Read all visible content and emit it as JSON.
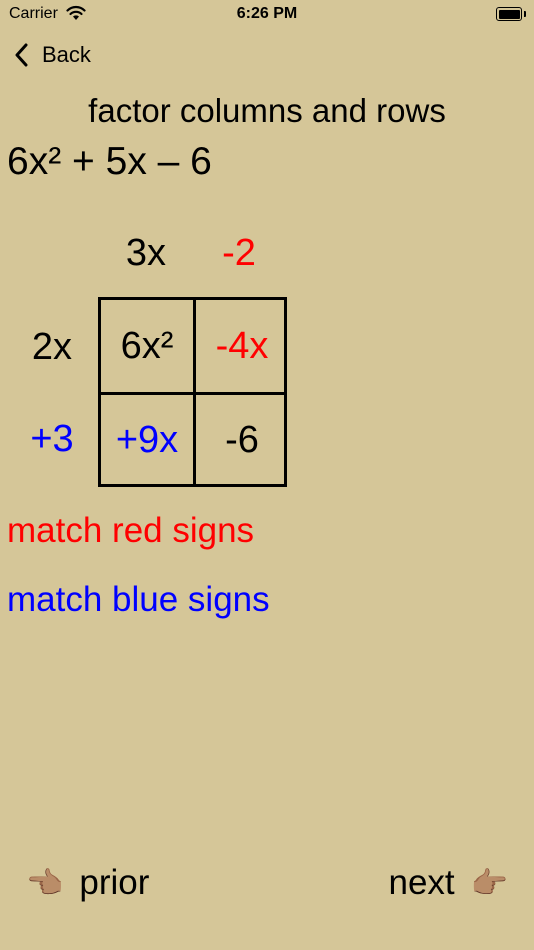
{
  "status_bar": {
    "carrier": "Carrier",
    "time": "6:26 PM",
    "icons": [
      "wifi-icon",
      "battery-icon"
    ]
  },
  "nav": {
    "back_label": "Back",
    "back_icon": "chevron-left-icon"
  },
  "title": "factor columns and rows",
  "expression": "6x² + 5x – 6",
  "grid": {
    "column_headers": [
      "3x",
      "-2"
    ],
    "row_headers": [
      "2x",
      "+3"
    ],
    "cells": [
      [
        "6x²",
        "-4x"
      ],
      [
        "+9x",
        "-6"
      ]
    ]
  },
  "hints": {
    "red": "match red signs",
    "blue": "match blue signs"
  },
  "footer": {
    "prior_label": "prior",
    "next_label": "next",
    "prior_icon": "👈🏽",
    "next_icon": "👉🏽"
  },
  "colors": {
    "background": "#D5C698",
    "red": "#FF0000",
    "blue": "#0000FF"
  }
}
